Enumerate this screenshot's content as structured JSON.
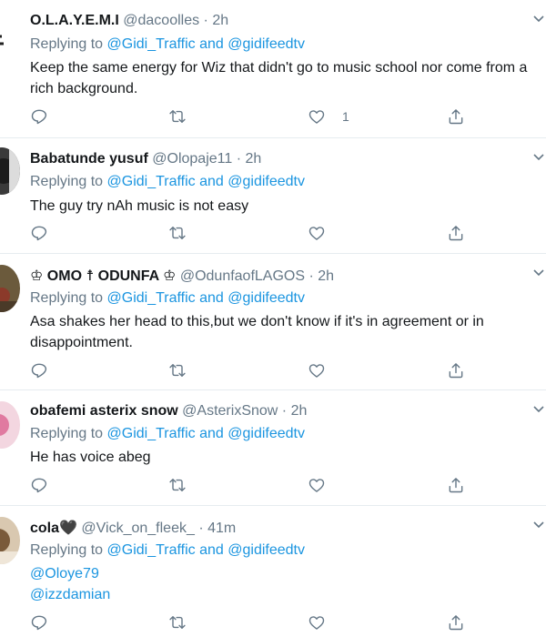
{
  "reply_prefix": "Replying to",
  "and_word": "and",
  "tweets": [
    {
      "name": "O.L.A.Y.E.M.I",
      "handle": "@dacoolles",
      "time": "2h",
      "reply_to": [
        "@Gidi_Traffic",
        "@gidifeedtv"
      ],
      "text": "Keep the same energy for Wiz that didn't go to music school nor come from a rich background.",
      "like_count": "1"
    },
    {
      "name": "Babatunde yusuf",
      "handle": "@Olopaje11",
      "time": "2h",
      "reply_to": [
        "@Gidi_Traffic",
        "@gidifeedtv"
      ],
      "text": "The guy try nAh music is not easy",
      "like_count": ""
    },
    {
      "name": "♔ OMO ☨ ODUNFA ♔",
      "handle": "@OdunfaofLAGOS",
      "time": "2h",
      "reply_to": [
        "@Gidi_Traffic",
        "@gidifeedtv"
      ],
      "text": "Asa shakes her head to this,but we don't know if it's in agreement or in disappointment.",
      "like_count": ""
    },
    {
      "name": "obafemi asterix snow",
      "handle": "@AsterixSnow",
      "time": "2h",
      "reply_to": [
        "@Gidi_Traffic",
        "@gidifeedtv"
      ],
      "text": "He has voice abeg",
      "like_count": ""
    },
    {
      "name": "cola🖤",
      "handle": "@Vick_on_fleek_",
      "time": "41m",
      "reply_to": [
        "@Gidi_Traffic",
        "@gidifeedtv"
      ],
      "text": "",
      "mentions": [
        "@Oloye79",
        "@izzdamian"
      ],
      "like_count": ""
    }
  ],
  "colors": {
    "accent": "#1b95e0",
    "muted": "#657786",
    "text": "#14171a",
    "divider": "#e6ecf0"
  },
  "icons": [
    "caret-down-icon",
    "reply-icon",
    "retweet-icon",
    "like-icon",
    "share-icon"
  ]
}
